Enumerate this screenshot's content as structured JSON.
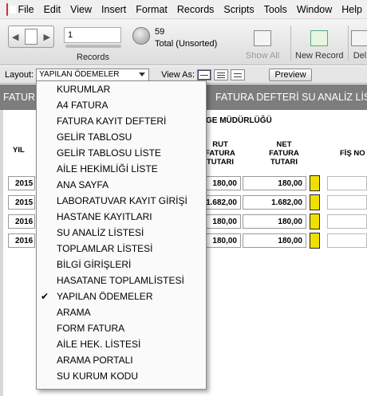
{
  "menubar": {
    "items": [
      "File",
      "Edit",
      "View",
      "Insert",
      "Format",
      "Records",
      "Scripts",
      "Tools",
      "Window",
      "Help"
    ]
  },
  "toolbar": {
    "record_number": "1",
    "records_label": "Records",
    "total_count": "59",
    "total_label": "Total (Unsorted)",
    "show_all": "Show All",
    "new_record": "New Record",
    "delete_record": "Del"
  },
  "layout_bar": {
    "layout_label": "Layout:",
    "layout_value": "YAPILAN ÖDEMELER",
    "view_as_label": "View As:",
    "preview": "Preview"
  },
  "tabs": {
    "left": "FATUR",
    "right": "FATURA DEFTERİ  SU ANALİZ LİSTE"
  },
  "table": {
    "hospital_text": "GE MÜDÜRLÜĞÜ",
    "headers": {
      "yil": "YIL",
      "brut": "RUT\nFATURA\nTUTARI",
      "net": "NET\nFATURA\nTUTARI",
      "fis": "FİŞ NO"
    },
    "rows": [
      {
        "year": "2015",
        "brut": "180,00",
        "net": "180,00"
      },
      {
        "year": "2015",
        "brut": "1.682,00",
        "net": "1.682,00"
      },
      {
        "year": "2016",
        "brut": "180,00",
        "net": "180,00"
      },
      {
        "year": "2016",
        "brut": "180,00",
        "net": "180,00"
      }
    ]
  },
  "dropdown": {
    "items": [
      {
        "label": "KURUMLAR",
        "checked": false
      },
      {
        "label": "A4 FATURA",
        "checked": false
      },
      {
        "label": "FATURA KAYIT DEFTERİ",
        "checked": false
      },
      {
        "label": "GELİR TABLOSU",
        "checked": false
      },
      {
        "label": "GELİR TABLOSU LİSTE",
        "checked": false
      },
      {
        "label": "AİLE HEKİMLİĞİ LİSTE",
        "checked": false
      },
      {
        "label": "ANA SAYFA",
        "checked": false
      },
      {
        "label": "LABORATUVAR KAYIT GİRİŞİ",
        "checked": false
      },
      {
        "label": "HASTANE KAYITLARI",
        "checked": false
      },
      {
        "label": "SU ANALİZ LİSTESİ",
        "checked": false
      },
      {
        "label": "TOPLAMLAR LİSTESİ",
        "checked": false
      },
      {
        "label": "BİLGİ GİRİŞLERİ",
        "checked": false
      },
      {
        "label": "HASATANE TOPLAMLİSTESİ",
        "checked": false
      },
      {
        "label": "YAPILAN ÖDEMELER",
        "checked": true
      },
      {
        "label": "ARAMA",
        "checked": false
      },
      {
        "label": "FORM FATURA",
        "checked": false
      },
      {
        "label": "AİLE HEK. LİSTESİ",
        "checked": false
      },
      {
        "label": "ARAMA PORTALI",
        "checked": false
      },
      {
        "label": "SU KURUM KODU",
        "checked": false
      }
    ],
    "check_glyph": "✔"
  }
}
